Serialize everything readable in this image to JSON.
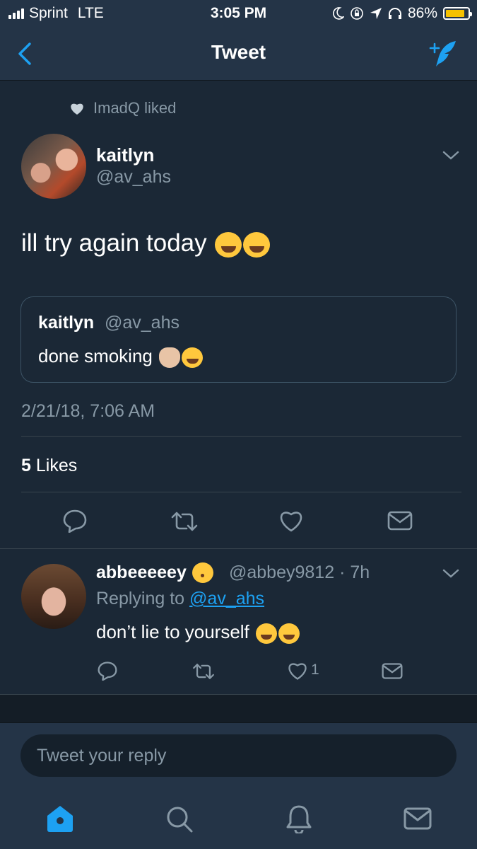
{
  "status_bar": {
    "carrier": "Sprint",
    "network": "LTE",
    "time": "3:05 PM",
    "battery_percent_label": "86%",
    "battery_level": 0.86,
    "battery_color": "#f5c100"
  },
  "nav": {
    "title": "Tweet",
    "back_icon": "chevron-left-icon",
    "compose_icon": "compose-tweet-icon"
  },
  "tweet": {
    "liked_by": "ImadQ liked",
    "author_name": "kaitlyn",
    "author_handle": "@av_ahs",
    "text": "ill try again today",
    "text_emoji": [
      "joy",
      "joy"
    ],
    "quote": {
      "name": "kaitlyn",
      "handle": "@av_ahs",
      "text": "done smoking",
      "text_emoji": [
        "waving-hand",
        "sweat-smile"
      ]
    },
    "timestamp": "2/21/18, 7:06 AM",
    "likes_count": "5",
    "likes_label": "Likes"
  },
  "reply": {
    "name": "abbeeeeey",
    "name_emoji": "kissing",
    "handle": "@abbey9812",
    "separator": "·",
    "age": "7h",
    "replying_prefix": "Replying to",
    "replying_to": "@av_ahs",
    "text": "don’t lie to yourself",
    "text_emoji": [
      "joy",
      "joy"
    ],
    "like_count": "1"
  },
  "composer": {
    "placeholder": "Tweet your reply"
  },
  "tab_bar": [
    "home-icon",
    "search-icon",
    "notifications-bell-icon",
    "messages-icon"
  ],
  "colors": {
    "background": "#1b2836",
    "bar": "#243447",
    "accent": "#1da1f2",
    "secondary_text": "#8899a6"
  }
}
